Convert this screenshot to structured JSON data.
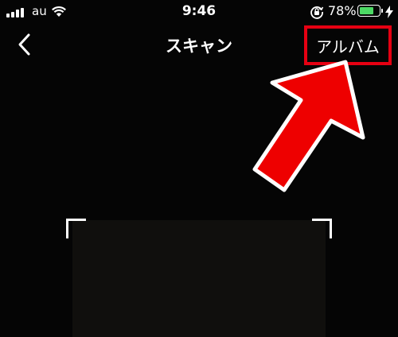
{
  "status_bar": {
    "carrier": "au",
    "time": "9:46",
    "battery_percent": "78%",
    "battery_level": 0.78,
    "icons": [
      "signal-icon",
      "wifi-icon",
      "rotation-lock-icon",
      "battery-icon",
      "charging-icon"
    ]
  },
  "nav": {
    "back_icon": "chevron-left-icon",
    "title": "スキャン",
    "album_label": "アルバム"
  },
  "annotation": {
    "highlight_color": "#e60012",
    "arrow_color": "#ee0000"
  },
  "scanner": {
    "corner_color": "#ffffff"
  }
}
